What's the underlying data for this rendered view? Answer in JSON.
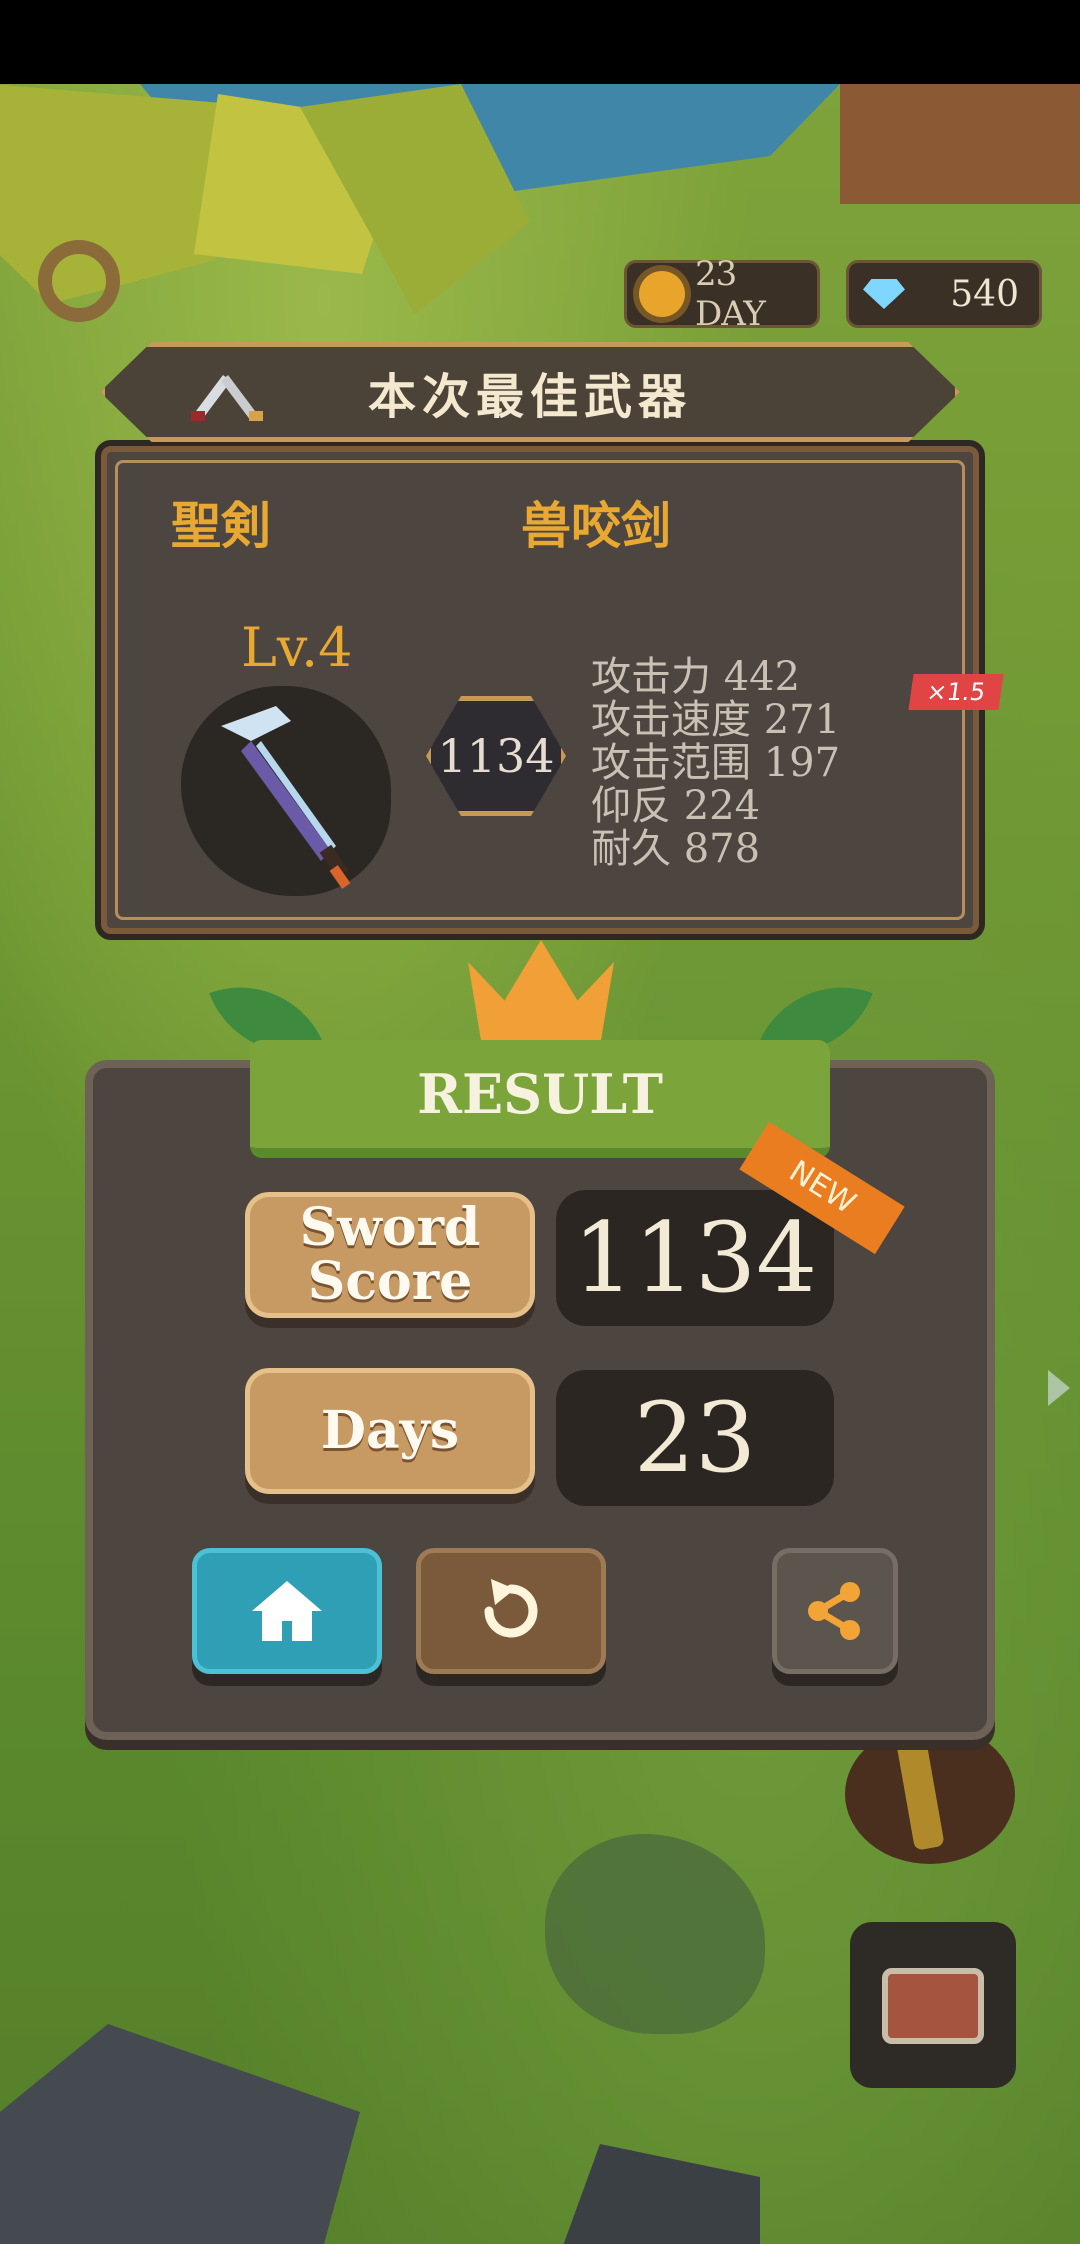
{
  "hud": {
    "day_label": "23 DAY",
    "gems": "540"
  },
  "best_weapon": {
    "banner_title": "本次最佳武器",
    "type": "聖剣",
    "name": "兽咬剑",
    "level": "Lv.4",
    "score": "1134",
    "stats": [
      {
        "label": "攻击力",
        "value": "442"
      },
      {
        "label": "攻击速度",
        "value": "271"
      },
      {
        "label": "攻击范围",
        "value": "197"
      },
      {
        "label": "仰反",
        "value": "224"
      },
      {
        "label": "耐久",
        "value": "878"
      }
    ],
    "multiplier": "×1.5"
  },
  "result": {
    "title": "RESULT",
    "sword_score_label": "Sword Score",
    "sword_score_value": "1134",
    "new_badge": "NEW",
    "days_label": "Days",
    "days_value": "23"
  },
  "icons": {
    "sun": "sun-icon",
    "gem": "gem-icon",
    "sword": "sword-icon",
    "home": "home-icon",
    "retry": "retry-icon",
    "share": "share-icon",
    "chest": "chest-icon"
  },
  "colors": {
    "accent_gold": "#e8a832",
    "result_green": "#7ba53a",
    "home_button": "#2f9fb5",
    "retry_button": "#7b5a3b"
  }
}
